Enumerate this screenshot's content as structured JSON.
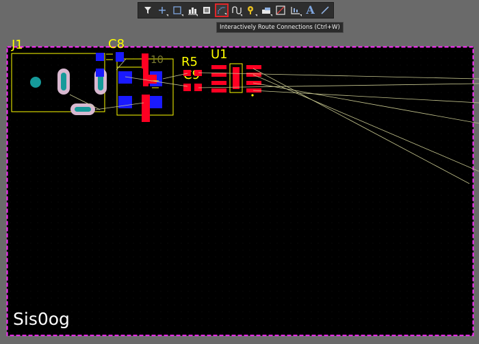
{
  "toolbar": {
    "buttons": [
      {
        "icon": "filter-icon"
      },
      {
        "icon": "crosshair-icon"
      },
      {
        "icon": "select-rect-icon"
      },
      {
        "icon": "align-icon"
      },
      {
        "icon": "component-icon"
      },
      {
        "icon": "route-icon",
        "active": true
      },
      {
        "icon": "diff-pair-icon"
      },
      {
        "icon": "via-icon"
      },
      {
        "icon": "fill-icon"
      },
      {
        "icon": "polygon-icon"
      },
      {
        "icon": "dimension-icon"
      },
      {
        "icon": "text-icon",
        "glyph": "A"
      },
      {
        "icon": "line-icon"
      }
    ]
  },
  "tooltip": {
    "text": "Interactively Route Connections (Ctrl+W)"
  },
  "board": {
    "designators": {
      "j1": "J1",
      "c8": "C8",
      "r5": "R5",
      "c9": "C9",
      "u1": "U1",
      "c10": "10"
    },
    "watermark": "Sis0og"
  },
  "colors": {
    "board_outline": "#ff2bff",
    "silkscreen": "#ffff00",
    "top_layer": "#ff0022",
    "bottom_layer": "#1a1aff",
    "pad_hole": "#169a9a",
    "ratsnest": "#c8c890"
  }
}
